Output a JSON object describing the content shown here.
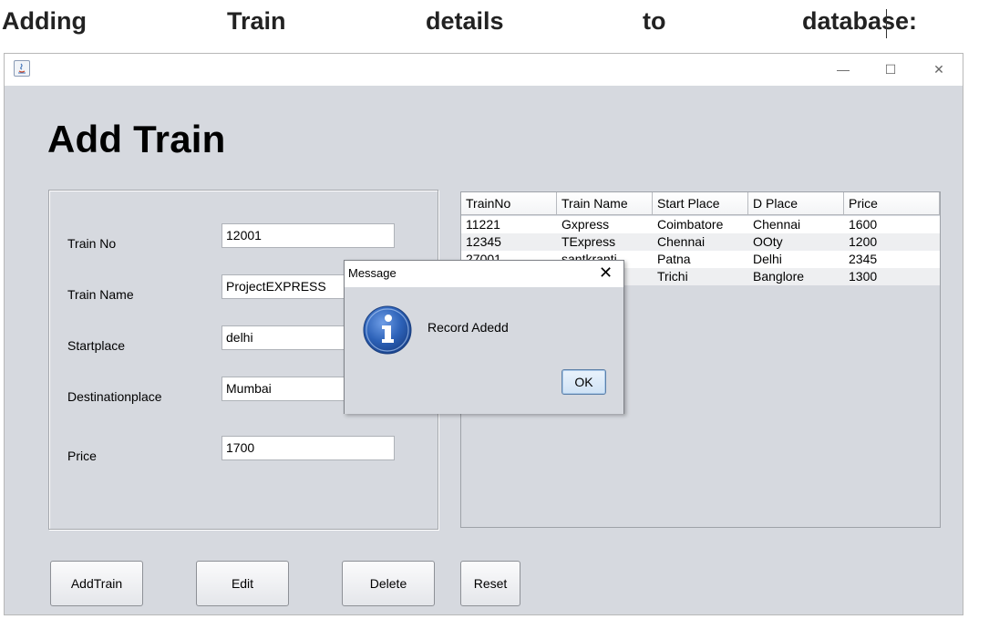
{
  "doc": {
    "heading_words": [
      "Adding",
      "Train",
      "details",
      "to",
      "database:"
    ]
  },
  "window": {
    "title": "",
    "controls": {
      "minimize": "—",
      "maximize": "☐",
      "close": "✕"
    }
  },
  "page_title": "Add Train",
  "form": {
    "fields": [
      {
        "label": "Train No",
        "value": "12001"
      },
      {
        "label": "Train Name",
        "value": "ProjectEXPRESS"
      },
      {
        "label": "Startplace",
        "value": "delhi"
      },
      {
        "label": "Destinationplace",
        "value": "Mumbai"
      },
      {
        "label": "Price",
        "value": "1700"
      }
    ]
  },
  "table": {
    "columns": [
      "TrainNo",
      "Train Name",
      "Start Place",
      "D Place",
      "Price"
    ],
    "rows": [
      [
        "11221",
        "Gxpress",
        "Coimbatore",
        "Chennai",
        "1600"
      ],
      [
        "12345",
        "TExpress",
        "Chennai",
        "OOty",
        "1200"
      ],
      [
        "27001",
        "santkranti",
        "Patna",
        "Delhi",
        "2345"
      ],
      [
        "",
        "",
        "Trichi",
        "Banglore",
        "1300"
      ]
    ]
  },
  "buttons": {
    "add": "AddTrain",
    "edit": "Edit",
    "delete": "Delete",
    "reset": "Reset"
  },
  "dialog": {
    "title": "Message",
    "close": "✕",
    "message": "Record Adedd",
    "ok": "OK",
    "icon": "info-icon"
  },
  "colors": {
    "window_bg": "#d6d9df",
    "info_icon_blue": "#2d62b8",
    "ok_border": "#5b7fa8"
  }
}
